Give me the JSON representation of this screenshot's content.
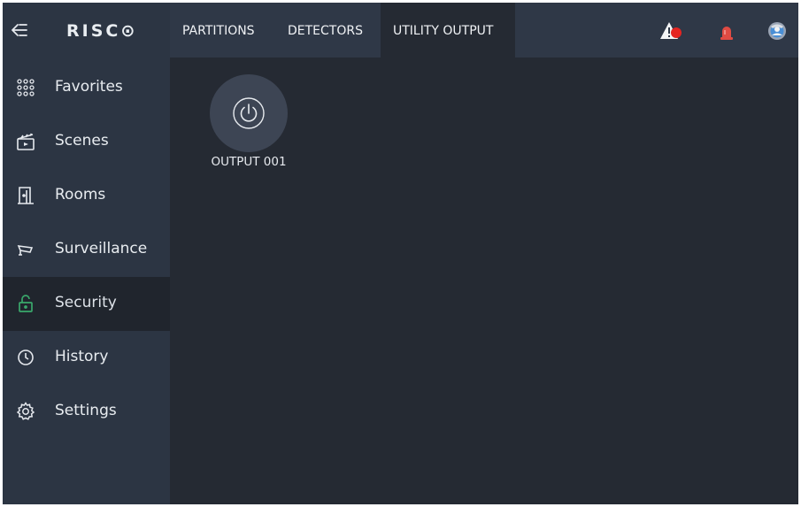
{
  "brand": {
    "logo_text": "RISC⊙"
  },
  "sidebar": {
    "items": [
      {
        "label": "Favorites",
        "icon": "grid-icon"
      },
      {
        "label": "Scenes",
        "icon": "clapperboard-icon"
      },
      {
        "label": "Rooms",
        "icon": "door-icon"
      },
      {
        "label": "Surveillance",
        "icon": "camera-icon"
      },
      {
        "label": "Security",
        "icon": "lock-icon",
        "active": true
      },
      {
        "label": "History",
        "icon": "history-icon"
      },
      {
        "label": "Settings",
        "icon": "gear-icon"
      }
    ]
  },
  "tabs": [
    {
      "label": "PARTITIONS"
    },
    {
      "label": "DETECTORS"
    },
    {
      "label": "UTILITY OUTPUT",
      "active": true
    }
  ],
  "top_icons": [
    "alert-triangle-icon",
    "siren-icon",
    "user-avatar-icon"
  ],
  "outputs": [
    {
      "label": "OUTPUT 001",
      "icon": "power-icon"
    }
  ],
  "colors": {
    "sidebar_bg": "#2c3543",
    "content_bg": "#252a33",
    "active_accent": "#3aa86b",
    "alert_red": "#e52421"
  }
}
